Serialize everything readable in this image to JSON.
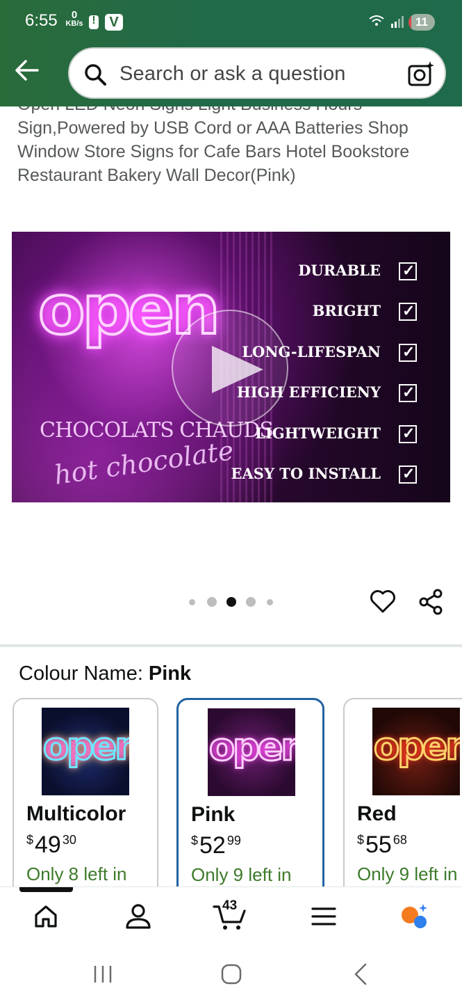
{
  "status_bar": {
    "time": "6:55",
    "net_speed_value": "0",
    "net_speed_unit": "KB/s",
    "app_badge": "V",
    "battery_level": "11",
    "battery_fill_percent": 11,
    "icons": [
      "alert-icon",
      "wifi-icon",
      "signal-icon",
      "battery-icon"
    ]
  },
  "header": {
    "search_placeholder": "Search or ask a question",
    "icons": [
      "back-arrow-icon",
      "search-icon",
      "camera-search-icon"
    ]
  },
  "product": {
    "title_lines": [
      "Open LED Neon Signs Light Business Hours",
      "Sign,Powered by USB Cord or AAA Batteries Shop",
      "Window Store Signs for Cafe Bars Hotel Bookstore",
      "Restaurant Bakery Wall Decor(Pink)"
    ]
  },
  "media": {
    "neon_text": "open",
    "chocolate_line1": "CHOCOLATS CHAUDS",
    "chocolate_line2": "hot chocolate",
    "features": [
      "DURABLE",
      "BRIGHT",
      "LONG-LIFESPAN",
      "HIGH EFFICIENY",
      "LIGHTWEIGHT",
      "EASY TO INSTALL"
    ],
    "carousel_dot_count": 5,
    "active_dot_index": 2
  },
  "colour": {
    "label": "Colour Name:",
    "selected_value": "Pink",
    "variants": [
      {
        "name": "Multicolor",
        "currency": "$",
        "whole": "49",
        "cents": "30",
        "stock": "Only 8 left in",
        "selected": false
      },
      {
        "name": "Pink",
        "currency": "$",
        "whole": "52",
        "cents": "99",
        "stock": "Only 9 left in",
        "selected": true
      },
      {
        "name": "Red",
        "currency": "$",
        "whole": "55",
        "cents": "68",
        "stock": "Only 9 left in",
        "selected": false
      }
    ]
  },
  "bottom_nav": {
    "items": [
      "home-icon",
      "account-icon",
      "cart-icon",
      "menu-icon",
      "rufus-icon"
    ],
    "cart_count": "43",
    "active_index": 0
  },
  "colors": {
    "header_green": "#216a49",
    "link_green": "#3d7a2a",
    "selected_border": "#2162a1"
  }
}
